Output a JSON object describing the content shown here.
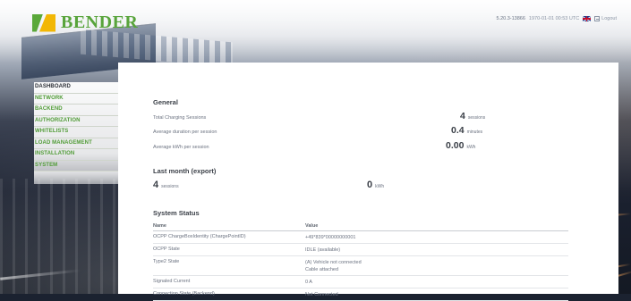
{
  "brand": {
    "name": "BENDER",
    "colors": {
      "green": "#58a43b",
      "yellow": "#f2b705"
    }
  },
  "topbar": {
    "version": "5.20.3-13866",
    "datetime": "1970-01-01 00:53 UTC",
    "language_flag": "uk-flag-icon",
    "logout_label": "Logout"
  },
  "sidebar": {
    "items": [
      {
        "label": "DASHBOARD",
        "active": true
      },
      {
        "label": "NETWORK",
        "active": false
      },
      {
        "label": "BACKEND",
        "active": false
      },
      {
        "label": "AUTHORIZATION",
        "active": false
      },
      {
        "label": "WHITELISTS",
        "active": false
      },
      {
        "label": "LOAD MANAGEMENT",
        "active": false
      },
      {
        "label": "INSTALLATION",
        "active": false
      },
      {
        "label": "SYSTEM",
        "active": false
      }
    ]
  },
  "general": {
    "title": "General",
    "stats": [
      {
        "label": "Total Charging Sessions",
        "value": "4",
        "unit": "sessions"
      },
      {
        "label": "Average duration per session",
        "value": "0.4",
        "unit": "minutes"
      },
      {
        "label": "Average kWh per session",
        "value": "0.00",
        "unit": "kWh"
      }
    ]
  },
  "last_month": {
    "title": "Last month (export)",
    "sessions": {
      "value": "4",
      "unit": "sessions"
    },
    "energy": {
      "value": "0",
      "unit": "kWh"
    }
  },
  "system_status": {
    "title": "System Status",
    "columns": [
      "Name",
      "Value"
    ],
    "rows": [
      {
        "name": "OCPP ChargeBoxIdentity (ChargePointID)",
        "value": [
          "+49*839*00000000001"
        ]
      },
      {
        "name": "OCPP State",
        "value": [
          "IDLE (available)"
        ]
      },
      {
        "name": "Type2 State",
        "value": [
          "(A) Vehicle not connected",
          "Cable attached"
        ]
      },
      {
        "name": "Signaled Current",
        "value": [
          "0 A"
        ]
      },
      {
        "name": "Connection State (Backend)",
        "value": [
          "Not Connected"
        ]
      }
    ]
  }
}
